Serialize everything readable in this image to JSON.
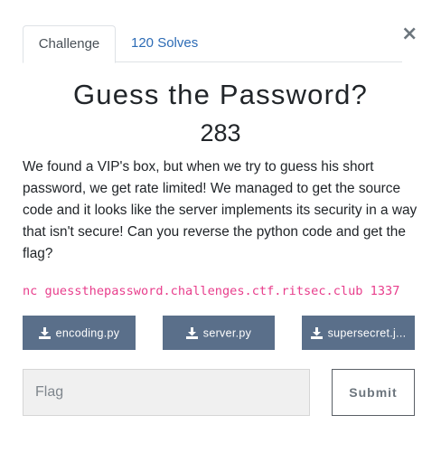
{
  "modal": {
    "close_glyph": "×",
    "tabs": [
      {
        "label": "Challenge",
        "active": true
      },
      {
        "label": "120 Solves",
        "active": false
      }
    ],
    "challenge": {
      "name": "Guess the Password?",
      "points": "283",
      "description": "We found a VIP's box, but when we try to guess his short password, we get rate limited! We managed to get the source code and it looks like the server implements its security in a way that isn't secure! Can you reverse the python code and get the flag?",
      "connection": "nc guessthepassword.challenges.ctf.ritsec.club 1337"
    },
    "files": [
      {
        "label": "encoding.py",
        "icon": "download-icon"
      },
      {
        "label": "server.py",
        "icon": "download-icon"
      },
      {
        "label": "supersecret.j...",
        "icon": "download-icon"
      }
    ],
    "flag_form": {
      "placeholder": "Flag",
      "value": "",
      "submit_label": "Submit"
    }
  },
  "colors": {
    "accent_link": "#2c6bb5",
    "file_button_bg": "#5a6f8a",
    "code_text": "#e83e8c"
  }
}
